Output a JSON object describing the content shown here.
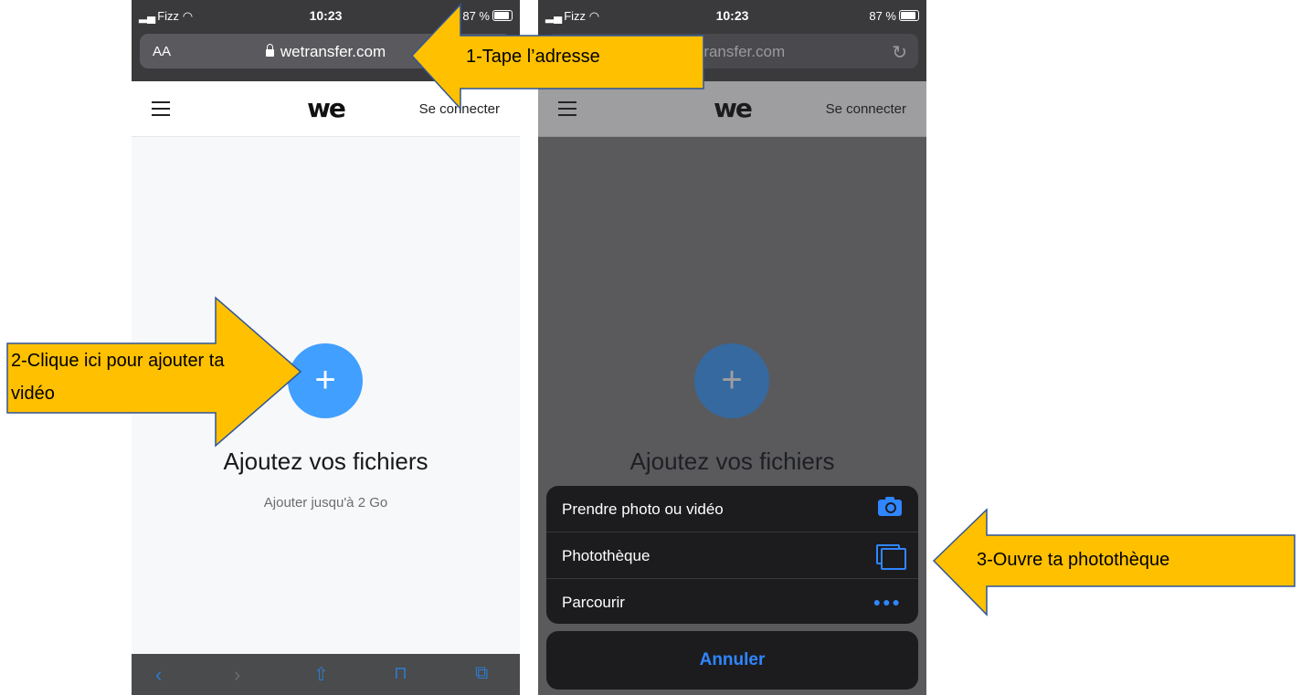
{
  "left_screen": {
    "status": {
      "carrier": "Fizz",
      "time": "10:23",
      "battery": "87 %"
    },
    "address_bar": {
      "text_size_label": "AA",
      "url": "wetransfer.com"
    },
    "nav": {
      "logo": "we",
      "login_label": "Se connecter"
    },
    "main": {
      "add_button_symbol": "+",
      "title": "Ajoutez vos fichiers",
      "subtitle": "Ajouter jusqu'à 2 Go"
    },
    "toolbar": {
      "back_icon": "back-icon",
      "forward_icon": "forward-icon",
      "share_icon": "share-icon",
      "bookmarks_icon": "bookmarks-icon",
      "tabs_icon": "tabs-icon"
    }
  },
  "right_screen": {
    "status": {
      "carrier": "Fizz",
      "time": "10:23",
      "battery": "87 %"
    },
    "address_bar": {
      "url": "wetransfer.com"
    },
    "nav": {
      "logo": "we",
      "login_label": "Se connecter"
    },
    "main": {
      "add_button_symbol": "+",
      "title": "Ajoutez vos fichiers"
    },
    "action_sheet": {
      "options": [
        {
          "label": "Prendre photo ou vidéo",
          "icon": "camera-icon"
        },
        {
          "label": "Photothèque",
          "icon": "photo-library-icon"
        },
        {
          "label": "Parcourir",
          "icon": "more-icon"
        }
      ],
      "cancel_label": "Annuler"
    }
  },
  "annotations": {
    "step1": "1-Tape l’adresse",
    "step2_line1": "2-Clique ici pour ajouter ta",
    "step2_line2": "vidéo",
    "step3": "3-Ouvre ta photothèque",
    "arrow_fill": "#ffc000",
    "arrow_stroke": "#2f5597"
  }
}
